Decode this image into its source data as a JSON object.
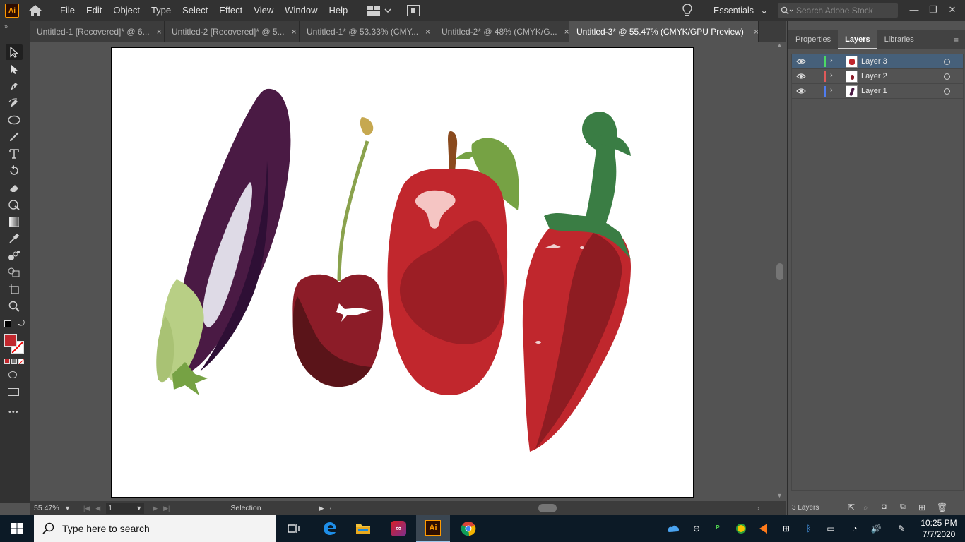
{
  "app": {
    "logo": "Ai",
    "menu": [
      "File",
      "Edit",
      "Object",
      "Type",
      "Select",
      "Effect",
      "View",
      "Window",
      "Help"
    ],
    "workspace": "Essentials",
    "stock_search_placeholder": "Search Adobe Stock"
  },
  "tabs": [
    {
      "label": "Untitled-1 [Recovered]* @ 6...",
      "active": false
    },
    {
      "label": "Untitled-2 [Recovered]* @ 5...",
      "active": false
    },
    {
      "label": "Untitled-1* @ 53.33% (CMY...",
      "active": false
    },
    {
      "label": "Untitled-2* @ 48% (CMYK/G...",
      "active": false
    },
    {
      "label": "Untitled-3* @ 55.47% (CMYK/GPU Preview)",
      "active": true
    }
  ],
  "tab_close": "×",
  "toolbar": {
    "tools": [
      "selection-tool",
      "direct-selection-tool",
      "pen-tool",
      "curvature-tool",
      "ellipse-tool",
      "paintbrush-tool",
      "type-tool",
      "rotate-tool",
      "eraser-tool",
      "warp-tool",
      "gradient-tool",
      "eyedropper-tool",
      "blend-tool",
      "shape-builder-tool",
      "artboard-tool",
      "zoom-tool"
    ],
    "fill_color": "#c1272d",
    "more": "•••"
  },
  "status": {
    "zoom": "55.47%",
    "artboard_number": "1",
    "tool_label": "Selection"
  },
  "panel": {
    "tabs": [
      "Properties",
      "Layers",
      "Libraries"
    ],
    "active_tab": "Layers",
    "layers": [
      {
        "name": "Layer 3",
        "color": "#4cd964",
        "active": true
      },
      {
        "name": "Layer 2",
        "color": "#e05a5a",
        "active": false
      },
      {
        "name": "Layer 1",
        "color": "#4f7cf0",
        "active": false
      }
    ],
    "count_label": "3 Layers"
  },
  "taskbar": {
    "search_placeholder": "Type here to search",
    "time": "10:25 PM",
    "date": "7/7/2020"
  },
  "colors": {
    "eggplant": "#4a1a44",
    "cherry": "#8c1c28",
    "apple": "#c1272d",
    "pepper": "#c0272d",
    "leaf": "#76a244",
    "stem_green": "#3a7d44"
  }
}
